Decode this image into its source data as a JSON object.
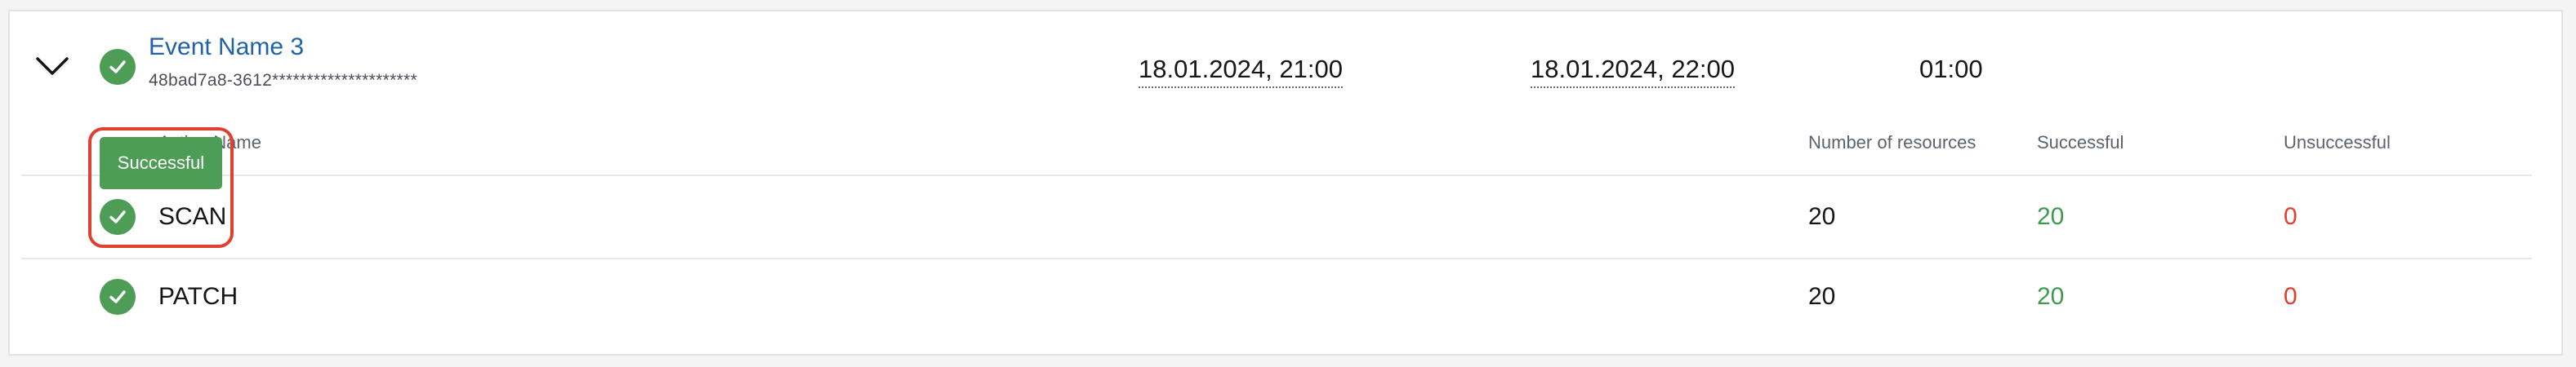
{
  "event": {
    "name": "Event Name 3",
    "id": "48bad7a8-3612*********************",
    "start": "18.01.2024, 21:00",
    "end": "18.01.2024, 22:00",
    "duration": "01:00",
    "status_icon": "check-circle-icon",
    "expand_icon": "chevron-down-icon"
  },
  "table": {
    "headers": {
      "action_name": "Action Name",
      "resources": "Number of resources",
      "successful": "Successful",
      "unsuccessful": "Unsuccessful"
    },
    "rows": [
      {
        "name": "SCAN",
        "resources": "20",
        "successful": "20",
        "unsuccessful": "0"
      },
      {
        "name": "PATCH",
        "resources": "20",
        "successful": "20",
        "unsuccessful": "0"
      }
    ]
  },
  "tooltip": {
    "text": "Successful"
  },
  "colors": {
    "success": "#4e9d57",
    "error": "#e0402f",
    "link": "#1f62a8"
  }
}
